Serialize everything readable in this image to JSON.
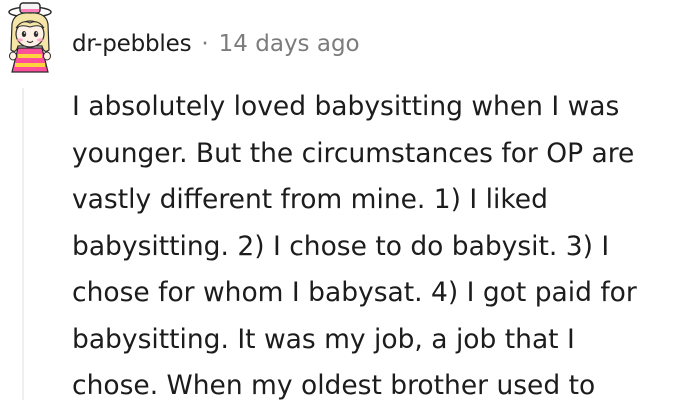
{
  "comment": {
    "username": "dr-pebbles",
    "separator": "·",
    "timestamp": "14 days ago",
    "avatar_icon": "kawaii-character-avatar-icon",
    "body_lines": [
      "I absolutely loved babysitting when I was",
      "younger. But the circumstances for OP are",
      "vastly different from mine. 1) I liked",
      "babysitting. 2) I chose to do babysit. 3) I",
      "chose for whom I babysat. 4) I got paid for",
      "babysitting. It was my job, a job that I",
      "chose. When my oldest brother used to"
    ]
  },
  "colors": {
    "text": "#1c1c1c",
    "meta": "#7c7c7c",
    "thread_line": "#edeff1",
    "background": "#ffffff"
  }
}
